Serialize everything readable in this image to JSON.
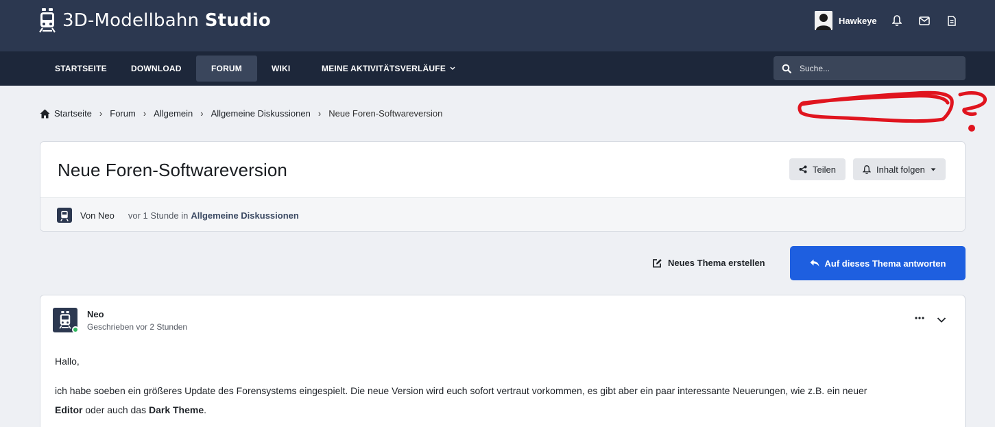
{
  "header": {
    "brand_light": "3D-Modellbahn",
    "brand_bold": "Studio",
    "user_name": "Hawkeye"
  },
  "nav": {
    "items": [
      {
        "label": "STARTSEITE"
      },
      {
        "label": "DOWNLOAD"
      },
      {
        "label": "FORUM",
        "active": true
      },
      {
        "label": "WIKI"
      },
      {
        "label": "MEINE AKTIVITÄTSVERLÄUFE"
      }
    ],
    "search_placeholder": "Suche..."
  },
  "breadcrumb": [
    "Startseite",
    "Forum",
    "Allgemein",
    "Allgemeine Diskussionen",
    "Neue Foren-Softwareversion"
  ],
  "thread": {
    "title": "Neue Foren-Softwareversion",
    "share_label": "Teilen",
    "follow_label": "Inhalt folgen",
    "author": "Von Neo",
    "time": "vor 1 Stunde in",
    "category": "Allgemeine Diskussionen"
  },
  "actions": {
    "new_thread_label": "Neues Thema erstellen",
    "reply_label": "Auf dieses Thema antworten"
  },
  "post": {
    "author": "Neo",
    "time": "Geschrieben vor 2 Stunden",
    "greeting": "Hallo,",
    "text_part1": "ich habe soeben ein größeres Update des Forensystems eingespielt. Die neue Version wird euch sofort vertraut vorkommen, es gibt aber ein paar interessante Neuerungen, wie z.B. ein neuer",
    "bold1": "Editor",
    "text_part2": "oder auch das",
    "bold2": "Dark Theme",
    "text_part3": "."
  },
  "colors": {
    "header_bg": "#2c3850",
    "nav_bg": "#1d273a",
    "accent": "#1e5fe0",
    "online": "#2fb65c",
    "annotation": "#e0141e"
  }
}
